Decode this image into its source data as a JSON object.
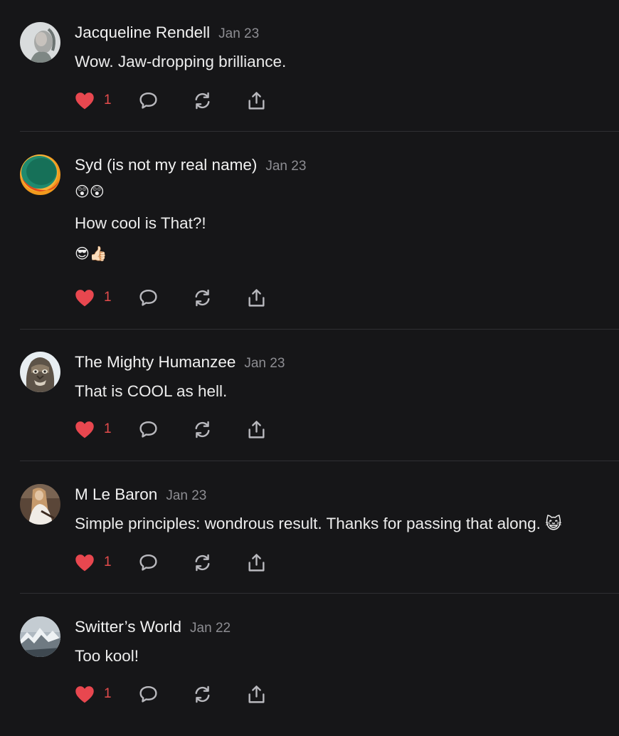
{
  "colors": {
    "background": "#161618",
    "heart": "#e8474f",
    "date": "#8d8d92",
    "separator": "#2f2f33"
  },
  "icons": [
    "heart-icon",
    "comment-icon",
    "repost-icon",
    "share-icon"
  ],
  "posts": [
    {
      "author": "Jacqueline Rendell",
      "date": "Jan 23",
      "lines": [
        "Wow. Jaw-dropping brilliance."
      ],
      "likes": "1"
    },
    {
      "author": "Syd (is not my real name)",
      "date": "Jan 23",
      "lines": [
        "😲😲",
        "How cool is That?!",
        "😎👍🏻"
      ],
      "likes": "1"
    },
    {
      "author": "The Mighty Humanzee",
      "date": "Jan 23",
      "lines": [
        "That is COOL as hell."
      ],
      "likes": "1"
    },
    {
      "author": "M Le Baron",
      "date": "Jan 23",
      "lines": [
        "Simple principles: wondrous result. Thanks for passing that along. 😺"
      ],
      "likes": "1"
    },
    {
      "author": "Switter’s World",
      "date": "Jan 22",
      "lines": [
        "Too kool!"
      ],
      "likes": "1"
    }
  ]
}
